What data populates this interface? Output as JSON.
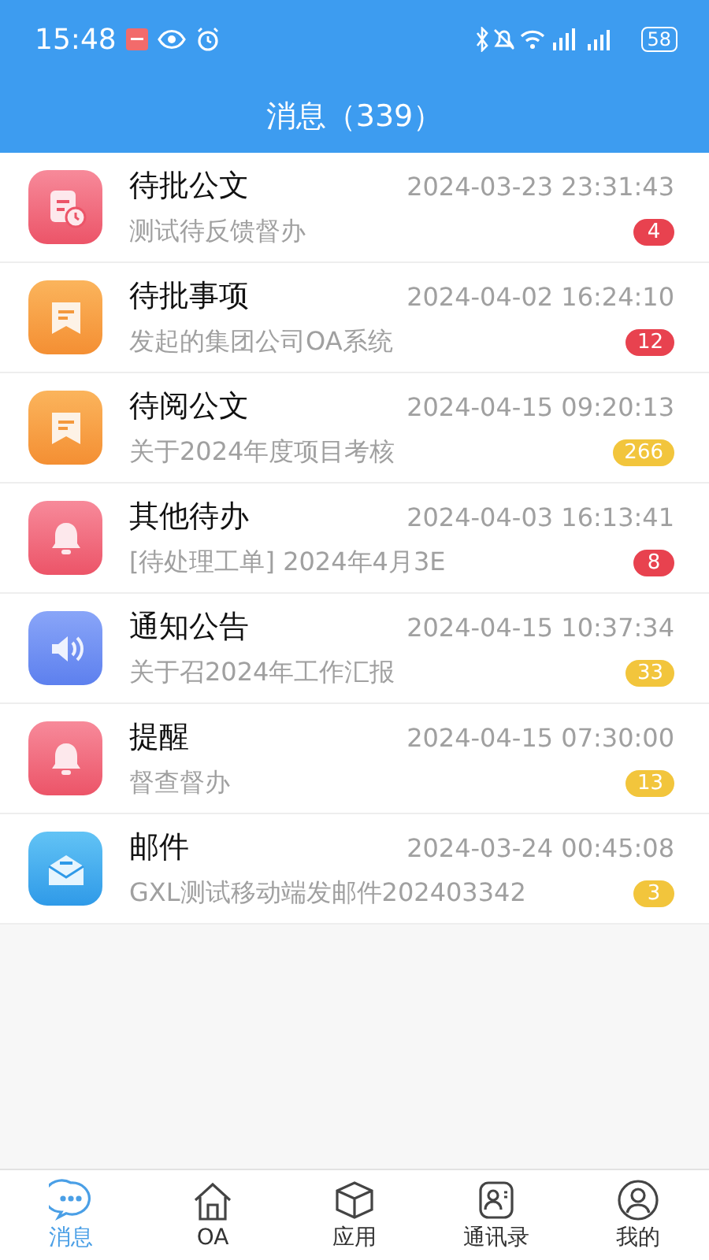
{
  "status_bar": {
    "time": "15:48",
    "battery": "58"
  },
  "header": {
    "title": "消息（339）"
  },
  "messages": [
    {
      "kind": "document",
      "title": "待批公文",
      "time": "2024-03-23 23:31:43",
      "preview": "测试待反馈督办",
      "count": "4",
      "color": "#e8424f"
    },
    {
      "kind": "note",
      "title": "待批事项",
      "time": "2024-04-02 16:24:10",
      "preview": "发起的集团公司OA系统",
      "count": "12",
      "color": "#e8424f"
    },
    {
      "kind": "note",
      "title": "待阅公文",
      "time": "2024-04-15 09:20:13",
      "preview": "关于2024年度项目考核",
      "count": "266",
      "color": "#f2c53c"
    },
    {
      "kind": "bell",
      "title": "其他待办",
      "time": "2024-04-03 16:13:41",
      "preview": "[待处理工单] 2024年4月3E",
      "count": "8",
      "color": "#e8424f"
    },
    {
      "kind": "speaker",
      "title": "通知公告",
      "time": "2024-04-15 10:37:34",
      "preview": "关于召2024年工作汇报",
      "count": "33",
      "color": "#f2c53c"
    },
    {
      "kind": "bell",
      "title": "提醒",
      "time": "2024-04-15 07:30:00",
      "preview": "督查督办",
      "count": "13",
      "color": "#f2c53c"
    },
    {
      "kind": "mail",
      "title": "邮件",
      "time": "2024-03-24 00:45:08",
      "preview": "GXL测试移动端发邮件202403342",
      "count": "3",
      "color": "#f2c53c"
    }
  ],
  "tabs": [
    {
      "kind": "chat",
      "label": "消息",
      "selected": true
    },
    {
      "kind": "home",
      "label": "OA",
      "selected": false
    },
    {
      "kind": "box",
      "label": "应用",
      "selected": false
    },
    {
      "kind": "contacts",
      "label": "通讯录",
      "selected": false
    },
    {
      "kind": "user",
      "label": "我的",
      "selected": false
    }
  ]
}
